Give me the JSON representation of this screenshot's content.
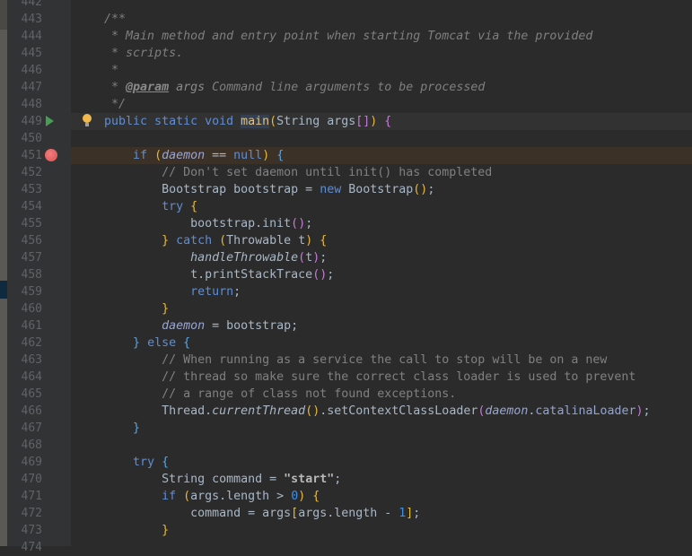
{
  "editor": {
    "first_line": 442,
    "caret_line": 449,
    "breakpoint_line": 451,
    "run_icon_line": 449,
    "intention_bulb_line": 449,
    "icons": {
      "run": "run-gutter-icon",
      "breakpoint": "breakpoint-icon",
      "bulb": "lightbulb-icon"
    },
    "lines": [
      [],
      [
        [
          "doc",
          "    /**"
        ]
      ],
      [
        [
          "doc",
          "     * Main method and entry point when starting Tomcat via the provided"
        ]
      ],
      [
        [
          "doc",
          "     * scripts."
        ]
      ],
      [
        [
          "doc",
          "     *"
        ]
      ],
      [
        [
          "doc",
          "     * "
        ],
        [
          "tag",
          "@param"
        ],
        [
          "doc",
          " "
        ],
        [
          "dparam",
          "args"
        ],
        [
          "doc",
          " Command line arguments to be processed"
        ]
      ],
      [
        [
          "doc",
          "     */"
        ]
      ],
      [
        [
          "kw",
          "    public static void "
        ],
        [
          "fn",
          "main"
        ],
        [
          "b1",
          "("
        ],
        [
          "p",
          "String args"
        ],
        [
          "b2",
          "[]"
        ],
        [
          "b1",
          ")"
        ],
        [
          "p",
          " "
        ],
        [
          "b2",
          "{"
        ]
      ],
      [],
      [
        [
          "kw",
          "        if "
        ],
        [
          "b1",
          "("
        ],
        [
          "st",
          "daemon"
        ],
        [
          "p",
          " == "
        ],
        [
          "kw",
          "null"
        ],
        [
          "b1",
          ")"
        ],
        [
          "p",
          " "
        ],
        [
          "b3",
          "{"
        ]
      ],
      [
        [
          "cm",
          "            // Don't set daemon until init() has completed"
        ]
      ],
      [
        [
          "p",
          "            Bootstrap bootstrap = "
        ],
        [
          "kw",
          "new "
        ],
        [
          "p",
          "Bootstrap"
        ],
        [
          "b1",
          "("
        ],
        [
          "b1",
          ")"
        ],
        [
          "p",
          ";"
        ]
      ],
      [
        [
          "kw",
          "            try "
        ],
        [
          "b1",
          "{"
        ]
      ],
      [
        [
          "p",
          "                bootstrap.init"
        ],
        [
          "b2",
          "("
        ],
        [
          "b2",
          ")"
        ],
        [
          "p",
          ";"
        ]
      ],
      [
        [
          "b1",
          "            }"
        ],
        [
          "kw",
          " catch "
        ],
        [
          "b1",
          "("
        ],
        [
          "p",
          "Throwable t"
        ],
        [
          "b1",
          ")"
        ],
        [
          "p",
          " "
        ],
        [
          "b1",
          "{"
        ]
      ],
      [
        [
          "sm",
          "                handleThrowable"
        ],
        [
          "b2",
          "("
        ],
        [
          "p",
          "t"
        ],
        [
          "b2",
          ")"
        ],
        [
          "p",
          ";"
        ]
      ],
      [
        [
          "p",
          "                t.printStackTrace"
        ],
        [
          "b2",
          "("
        ],
        [
          "b2",
          ")"
        ],
        [
          "p",
          ";"
        ]
      ],
      [
        [
          "kw",
          "                return"
        ],
        [
          "p",
          ";"
        ]
      ],
      [
        [
          "b1",
          "            }"
        ]
      ],
      [
        [
          "st",
          "            daemon"
        ],
        [
          "p",
          " = bootstrap;"
        ]
      ],
      [
        [
          "b3",
          "        }"
        ],
        [
          "kw",
          " else "
        ],
        [
          "b3",
          "{"
        ]
      ],
      [
        [
          "cm",
          "            // When running as a service the call to stop will be on a new"
        ]
      ],
      [
        [
          "cm",
          "            // thread so make sure the correct class loader is used to prevent"
        ]
      ],
      [
        [
          "cm",
          "            // a range of class not found exceptions."
        ]
      ],
      [
        [
          "p",
          "            Thread."
        ],
        [
          "sm",
          "currentThread"
        ],
        [
          "b1",
          "("
        ],
        [
          "b1",
          ")"
        ],
        [
          "p",
          ".setContextClassLoader"
        ],
        [
          "b2",
          "("
        ],
        [
          "st",
          "daemon"
        ],
        [
          "p",
          "."
        ],
        [
          "fld",
          "catalinaLoader"
        ],
        [
          "b2",
          ")"
        ],
        [
          "p",
          ";"
        ]
      ],
      [
        [
          "b3",
          "        }"
        ]
      ],
      [],
      [
        [
          "kw",
          "        try "
        ],
        [
          "b3",
          "{"
        ]
      ],
      [
        [
          "p",
          "            String command = "
        ],
        [
          "str",
          "\"start\""
        ],
        [
          "p",
          ";"
        ]
      ],
      [
        [
          "kw",
          "            if "
        ],
        [
          "b1",
          "("
        ],
        [
          "p",
          "args.length > "
        ],
        [
          "num",
          "0"
        ],
        [
          "b1",
          ")"
        ],
        [
          "p",
          " "
        ],
        [
          "b1",
          "{"
        ]
      ],
      [
        [
          "p",
          "                command = args"
        ],
        [
          "b1",
          "["
        ],
        [
          "p",
          "args.length - "
        ],
        [
          "num",
          "1"
        ],
        [
          "b1",
          "]"
        ],
        [
          "p",
          ";"
        ]
      ],
      [
        [
          "b1",
          "            }"
        ]
      ],
      []
    ]
  }
}
